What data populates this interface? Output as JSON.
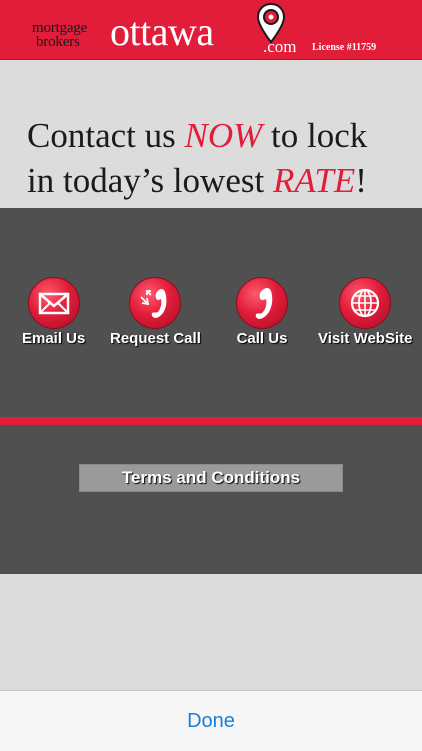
{
  "header": {
    "logo_top_word": "mortgage",
    "logo_second_word": "brokers",
    "logo_main_word": "ottawa",
    "logo_suffix": ".com",
    "license": "License #11759",
    "background_color": "#e11d3a"
  },
  "promo": {
    "line1_before": "Contact us ",
    "line1_highlight": "NOW",
    "line1_after": " to lock",
    "line2_before": "in today’s lowest ",
    "line2_highlight": "RATE",
    "line2_after": "!",
    "highlight_color": "#e11d3a"
  },
  "actions": [
    {
      "label": "Email Us",
      "icon": "envelope-icon"
    },
    {
      "label": "Request Call",
      "icon": "phone-callback-icon"
    },
    {
      "label": "Call Us",
      "icon": "phone-icon"
    },
    {
      "label": "Visit WebSite",
      "icon": "globe-icon"
    }
  ],
  "terms": {
    "label": "Terms and Conditions"
  },
  "bottom_bar": {
    "done_label": "Done",
    "done_color": "#1a7fd6"
  }
}
